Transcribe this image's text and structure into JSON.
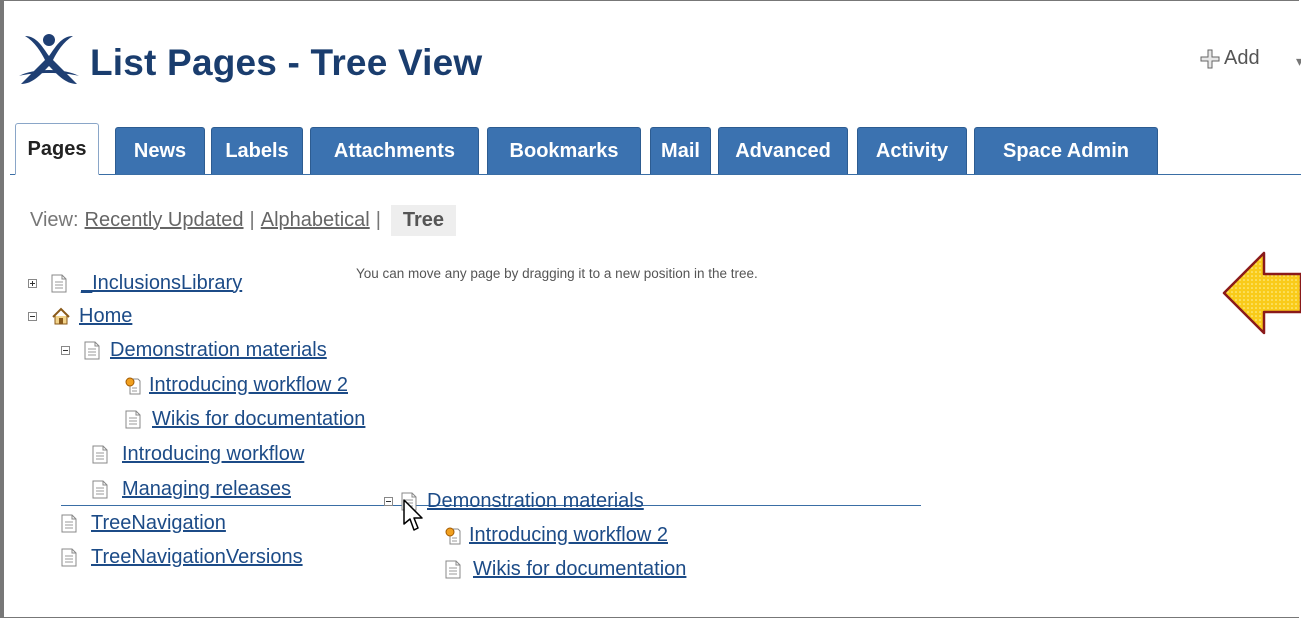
{
  "header": {
    "title": "List Pages - Tree View",
    "add_label": "Add",
    "add_caret": "▾"
  },
  "tabs": [
    {
      "label": "Pages",
      "active": true
    },
    {
      "label": "News"
    },
    {
      "label": "Labels"
    },
    {
      "label": "Attachments"
    },
    {
      "label": "Bookmarks"
    },
    {
      "label": "Mail"
    },
    {
      "label": "Advanced"
    },
    {
      "label": "Activity"
    },
    {
      "label": "Space Admin"
    }
  ],
  "view": {
    "prefix": "View:",
    "recently_updated": "Recently Updated",
    "separator": "|",
    "alphabetical": "Alphabetical",
    "current": "Tree"
  },
  "hint": "You can move any page by dragging it to a new position in the tree.",
  "tree": {
    "inclusions_library": "_InclusionsLibrary",
    "home": "Home",
    "demonstration_materials": "Demonstration materials",
    "introducing_workflow_2": "Introducing workflow 2",
    "wikis_for_documentation": "Wikis for documentation",
    "introducing_workflow": "Introducing workflow",
    "managing_releases": "Managing releases",
    "tree_navigation": "TreeNavigation",
    "tree_navigation_versions": "TreeNavigationVersions"
  },
  "drag_ghost": {
    "demonstration_materials": "Demonstration materials",
    "introducing_workflow_2": "Introducing workflow 2",
    "wikis_for_documentation": "Wikis for documentation"
  },
  "colors": {
    "title": "#1a3d6e",
    "tab_bg": "#3b72b0",
    "link": "#1c4b87",
    "callout_arrow": "#f7c600"
  },
  "icons": [
    "confluence-logo-icon",
    "plus-icon",
    "expand-icon",
    "collapse-icon",
    "page-icon",
    "home-icon",
    "workflow-page-icon",
    "mouse-cursor-icon",
    "left-arrow-icon"
  ]
}
